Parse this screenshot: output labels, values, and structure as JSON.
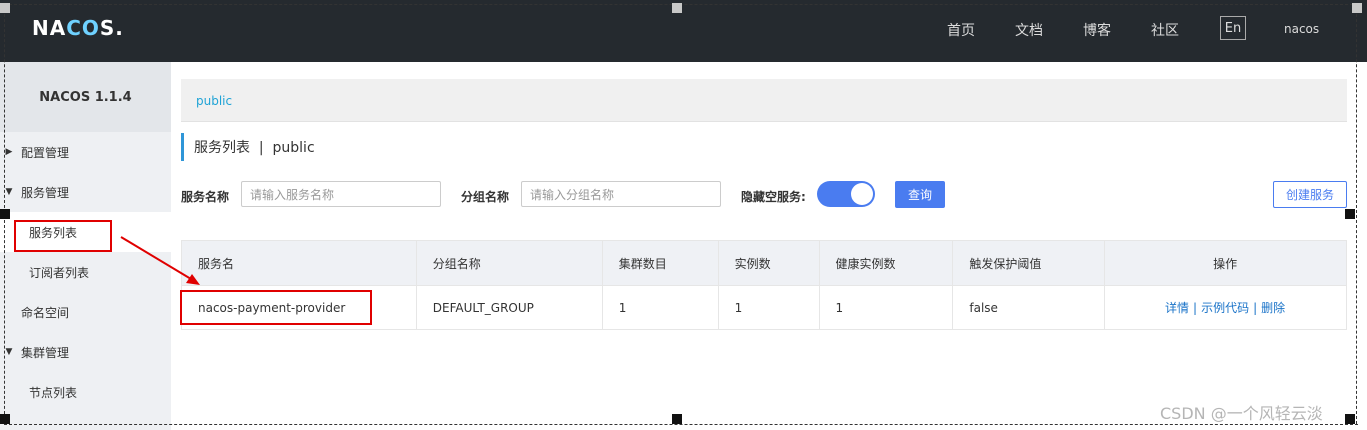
{
  "header": {
    "logo": {
      "left": "NA",
      "mid": "CO",
      "right": "S."
    },
    "nav": [
      "首页",
      "文档",
      "博客",
      "社区"
    ],
    "lang_button": "En",
    "user": "nacos"
  },
  "sidebar": {
    "version": "NACOS 1.1.4",
    "items": [
      {
        "label": "配置管理",
        "caret": "▶"
      },
      {
        "label": "服务管理",
        "caret": "▼"
      },
      {
        "label": "服务列表"
      },
      {
        "label": "订阅者列表"
      },
      {
        "label": "命名空间"
      },
      {
        "label": "集群管理",
        "caret": "▼"
      },
      {
        "label": "节点列表"
      }
    ]
  },
  "namespace_tab": "public",
  "page_title": "服务列表  |  public",
  "filters": {
    "service_name_label": "服务名称",
    "service_name_placeholder": "请输入服务名称",
    "group_name_label": "分组名称",
    "group_name_placeholder": "请输入分组名称",
    "hide_empty_label": "隐藏空服务:",
    "query_button": "查询",
    "create_button": "创建服务"
  },
  "table": {
    "headers": [
      "服务名",
      "分组名称",
      "集群数目",
      "实例数",
      "健康实例数",
      "触发保护阈值",
      "操作"
    ],
    "rows": [
      {
        "service": "nacos-payment-provider",
        "group": "DEFAULT_GROUP",
        "clusters": "1",
        "instances": "1",
        "healthy": "1",
        "threshold": "false",
        "actions": [
          "详情",
          "示例代码",
          "删除"
        ],
        "sep": "|"
      }
    ]
  },
  "watermark": "CSDN @一个风轻云淡",
  "colors": {
    "accent": "#4a7cf0",
    "header_bg": "#252a2f",
    "annotation_red": "#e00000"
  }
}
